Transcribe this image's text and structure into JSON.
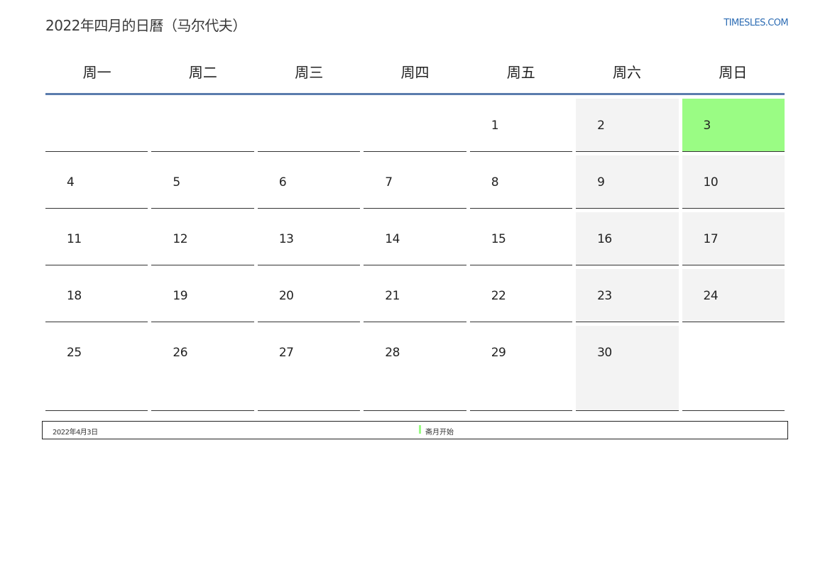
{
  "header": {
    "title": "2022年四月的日曆（马尔代夫）",
    "brand": "TIMESLES.COM"
  },
  "weekdays": [
    "周一",
    "周二",
    "周三",
    "周四",
    "周五",
    "周六",
    "周日"
  ],
  "weeks": [
    [
      "",
      "",
      "",
      "",
      "1",
      "2",
      "3"
    ],
    [
      "4",
      "5",
      "6",
      "7",
      "8",
      "9",
      "10"
    ],
    [
      "11",
      "12",
      "13",
      "14",
      "15",
      "16",
      "17"
    ],
    [
      "18",
      "19",
      "20",
      "21",
      "22",
      "23",
      "24"
    ],
    [
      "25",
      "26",
      "27",
      "28",
      "29",
      "30",
      ""
    ]
  ],
  "highlight_color": "#9afc84",
  "weekend_color": "#f3f3f3",
  "legend": {
    "date": "2022年4月3日",
    "label": "斋月开始"
  }
}
